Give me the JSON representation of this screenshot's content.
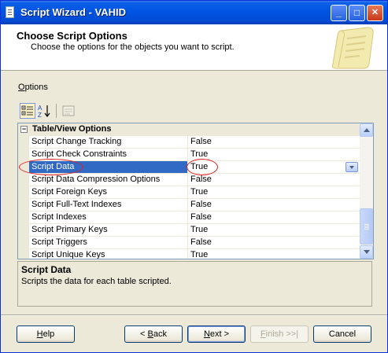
{
  "window": {
    "title": "Script Wizard - VAHID",
    "controls": {
      "minimize": "_",
      "maximize": "□",
      "close": "✕"
    }
  },
  "header": {
    "title": "Choose Script Options",
    "subtitle": "Choose the options for the objects you want to script."
  },
  "options_label": {
    "accesskey": "O",
    "rest": "ptions"
  },
  "toolbar": {
    "icons": [
      "categorized-icon",
      "alphabetical-icon",
      "property-pages-icon"
    ]
  },
  "grid": {
    "category": "Table/View Options",
    "category_toggle": "−",
    "rows": [
      {
        "name": "Script Change Tracking",
        "value": "False"
      },
      {
        "name": "Script Check Constraints",
        "value": "True"
      },
      {
        "name": "Script Data",
        "value": "True",
        "selected": true
      },
      {
        "name": "Script Data Compression Options",
        "value": "False"
      },
      {
        "name": "Script Foreign Keys",
        "value": "True"
      },
      {
        "name": "Script Full-Text Indexes",
        "value": "False"
      },
      {
        "name": "Script Indexes",
        "value": "False"
      },
      {
        "name": "Script Primary Keys",
        "value": "True"
      },
      {
        "name": "Script Triggers",
        "value": "False"
      },
      {
        "name": "Script Unique Keys",
        "value": "True"
      }
    ]
  },
  "description": {
    "title": "Script Data",
    "text": "Scripts the data for each table scripted."
  },
  "buttons": {
    "help": {
      "accesskey": "H",
      "rest": "elp"
    },
    "back": {
      "prefix": "< ",
      "accesskey": "B",
      "rest": "ack"
    },
    "next": {
      "accesskey": "N",
      "rest": "ext >"
    },
    "finish": {
      "accesskey": "F",
      "rest": "inish >>|"
    },
    "cancel": "Cancel"
  },
  "colors": {
    "selection": "#316ac5",
    "title_bar": "#0053e1",
    "annotation": "#e02020"
  }
}
